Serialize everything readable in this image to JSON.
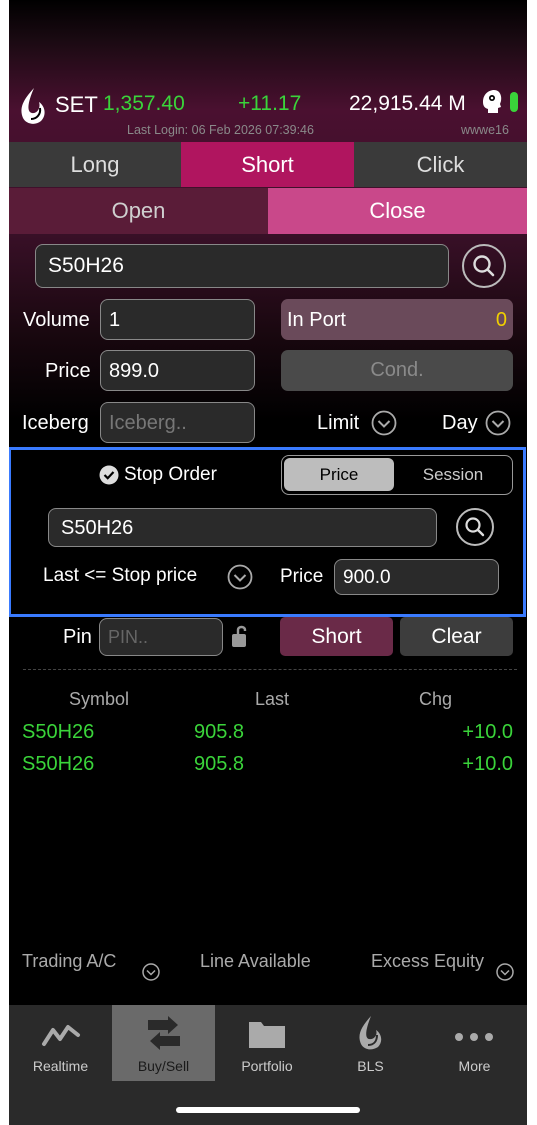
{
  "header": {
    "index_name": "SET",
    "index_value": "1,357.40",
    "index_change": "+11.17",
    "volume": "22,915.44 M",
    "last_login": "Last Login: 06 Feb 2026 07:39:46",
    "username": "wwwe16"
  },
  "tabs": {
    "long": "Long",
    "short": "Short",
    "click": "Click",
    "active": "Short"
  },
  "subtabs": {
    "open": "Open",
    "close": "Close",
    "active": "Close"
  },
  "order": {
    "symbol": "S50H26",
    "volume_label": "Volume",
    "volume_value": "1",
    "in_port_label": "In Port",
    "in_port_value": "0",
    "price_label": "Price",
    "price_value": "899.0",
    "cond_label": "Cond.",
    "iceberg_label": "Iceberg",
    "iceberg_placeholder": "Iceberg..",
    "limit_label": "Limit",
    "day_label": "Day"
  },
  "stop_order": {
    "label": "Stop Order",
    "checked": true,
    "seg_price": "Price",
    "seg_session": "Session",
    "active_segment": "Price",
    "symbol": "S50H26",
    "condition": "Last <= Stop price",
    "price_label": "Price",
    "price_value": "900.0"
  },
  "actions": {
    "pin_label": "Pin",
    "pin_placeholder": "PIN..",
    "submit_label": "Short",
    "clear_label": "Clear"
  },
  "quotes": {
    "headers": [
      "Symbol",
      "Last",
      "Chg"
    ],
    "rows": [
      [
        "S50H26",
        "905.8",
        "+10.0"
      ],
      [
        "S50H26",
        "905.8",
        "+10.0"
      ]
    ]
  },
  "account": {
    "trading_ac": "Trading A/C",
    "line_available": "Line Available",
    "excess_equity": "Excess Equity"
  },
  "bottom_nav": [
    {
      "label": "Realtime",
      "icon": "chart-line-icon"
    },
    {
      "label": "Buy/Sell",
      "icon": "swap-arrows-icon",
      "active": true
    },
    {
      "label": "Portfolio",
      "icon": "folder-icon"
    },
    {
      "label": "BLS",
      "icon": "bls-flame-icon"
    },
    {
      "label": "More",
      "icon": "more-dots-icon"
    }
  ],
  "colors": {
    "accent": "#b0155f",
    "green": "#3ad43a",
    "yellow": "#f0d000",
    "highlight_border": "#3a7bff"
  }
}
